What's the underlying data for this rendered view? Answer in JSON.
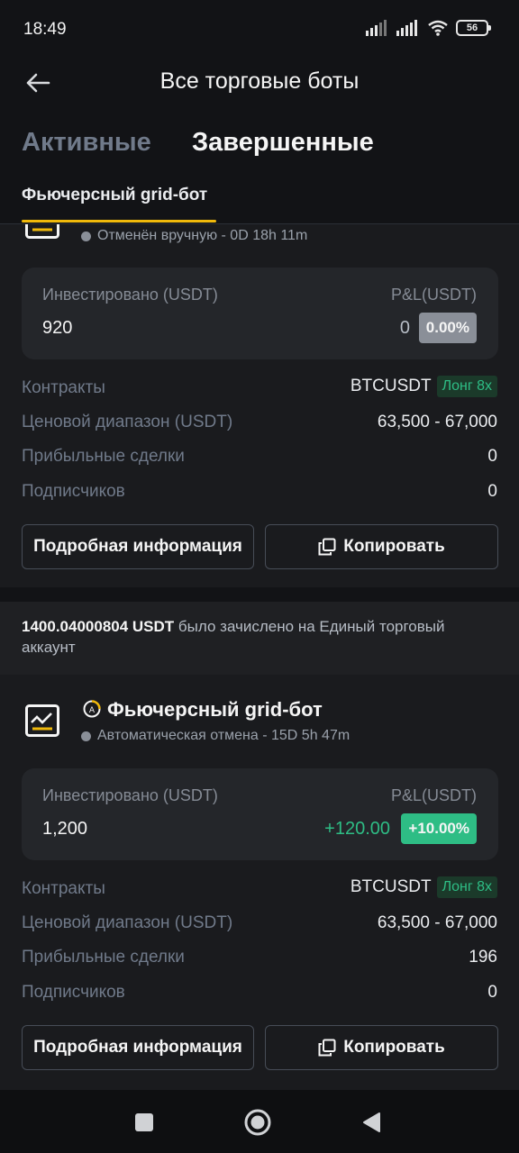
{
  "status_bar": {
    "time": "18:49",
    "battery": "56"
  },
  "header": {
    "title": "Все торговые боты"
  },
  "tabs": [
    {
      "label": "Активные",
      "active": false
    },
    {
      "label": "Завершенные",
      "active": true
    }
  ],
  "subtab": {
    "label": "Фьючерсный grid-бот"
  },
  "bots": [
    {
      "status": "Отменён вручную - 0D 18h 11m",
      "invested_label": "Инвестировано (USDT)",
      "invested_value": "920",
      "pnl_label": "P&L(USDT)",
      "pnl_value": "0",
      "pnl_percent": "0.00%",
      "rows": [
        {
          "label": "Контракты",
          "value": "BTCUSDT",
          "tag": "Лонг 8x"
        },
        {
          "label": "Ценовой диапазон (USDT)",
          "value": "63,500 - 67,000"
        },
        {
          "label": "Прибыльные сделки",
          "value": "0"
        },
        {
          "label": "Подписчиков",
          "value": "0"
        }
      ],
      "details_button": "Подробная информация",
      "copy_button": "Копировать"
    },
    {
      "name": "Фьючерсный grid-бот",
      "status": "Автоматическая отмена - 15D 5h 47m",
      "invested_label": "Инвестировано (USDT)",
      "invested_value": "1,200",
      "pnl_label": "P&L(USDT)",
      "pnl_value": "+120.00",
      "pnl_percent": "+10.00%",
      "rows": [
        {
          "label": "Контракты",
          "value": "BTCUSDT",
          "tag": "Лонг 8x"
        },
        {
          "label": "Ценовой диапазон (USDT)",
          "value": "63,500 - 67,000"
        },
        {
          "label": "Прибыльные сделки",
          "value": "196"
        },
        {
          "label": "Подписчиков",
          "value": "0"
        }
      ],
      "details_button": "Подробная информация",
      "copy_button": "Копировать"
    }
  ],
  "notice": {
    "amount": "1400.04000804 USDT",
    "text": " было зачислено на Единый торговый аккаунт"
  },
  "colors": {
    "accent": "#F0B90B",
    "positive": "#2EBD85",
    "neutral_badge": "#B7BDC6"
  },
  "icons": [
    "back-arrow-icon",
    "signal-icon",
    "wifi-icon",
    "battery-icon",
    "grid-bot-icon",
    "copy-icon",
    "square-nav-icon",
    "home-circle-nav-icon",
    "back-triangle-nav-icon"
  ]
}
